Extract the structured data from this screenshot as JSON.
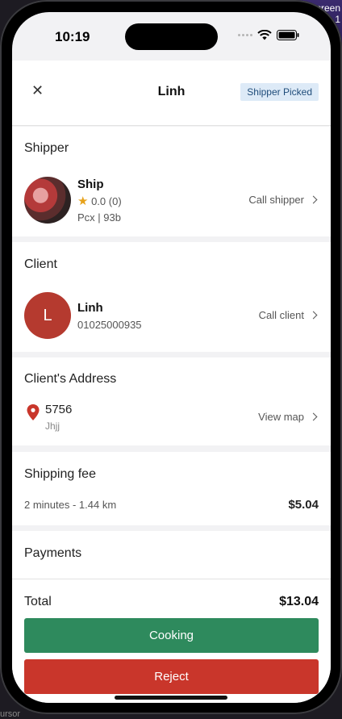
{
  "background": {
    "corner_text_line1": "Screen",
    "corner_text_line2": "...1",
    "bottom_text": "ursor"
  },
  "status_bar": {
    "time": "10:19"
  },
  "header": {
    "close_icon": "close-icon",
    "title": "Linh",
    "status_badge": "Shipper Picked"
  },
  "shipper": {
    "section_title": "Shipper",
    "name": "Ship",
    "rating": "0.0 (0)",
    "vehicle": "Pcx | 93b",
    "action_label": "Call shipper"
  },
  "client": {
    "section_title": "Client",
    "avatar_letter": "L",
    "name": "Linh",
    "phone": "01025000935",
    "action_label": "Call client"
  },
  "address": {
    "section_title": "Client's Address",
    "line1": "5756",
    "line2": "Jhjj",
    "action_label": "View map"
  },
  "shipping_fee": {
    "section_title": "Shipping fee",
    "details": "2 minutes - 1.44 km",
    "amount": "$5.04"
  },
  "payments": {
    "section_title": "Payments"
  },
  "footer": {
    "total_label": "Total",
    "total_value": "$13.04",
    "primary_button": "Cooking",
    "secondary_button": "Reject"
  },
  "colors": {
    "green": "#2e8a5d",
    "red": "#c9362b",
    "avatar_red": "#b53a2f",
    "badge_bg": "#ddeaf7",
    "star": "#e7a21b"
  }
}
